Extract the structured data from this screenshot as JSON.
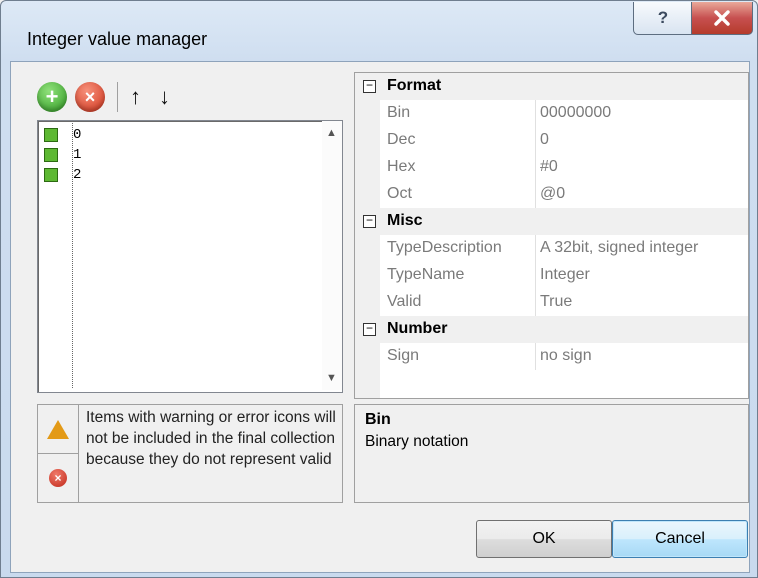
{
  "window": {
    "title": "Integer value manager",
    "help_glyph": "?",
    "close_glyph": "X"
  },
  "toolbar": {
    "add_glyph": "+",
    "remove_glyph": "×",
    "up_glyph": "↑",
    "down_glyph": "↓"
  },
  "list": {
    "items": [
      {
        "label": "0"
      },
      {
        "label": "1"
      },
      {
        "label": "2"
      }
    ]
  },
  "warning": {
    "text": "Items with warning or error icons will not be included in the final collection because they do not represent valid"
  },
  "property_grid": {
    "categories": [
      {
        "name": "Format",
        "expander": "−",
        "properties": [
          {
            "name": "Bin",
            "value": "00000000"
          },
          {
            "name": "Dec",
            "value": "0"
          },
          {
            "name": "Hex",
            "value": "#0"
          },
          {
            "name": "Oct",
            "value": "@0"
          }
        ]
      },
      {
        "name": "Misc",
        "expander": "−",
        "properties": [
          {
            "name": "TypeDescription",
            "value": "A 32bit, signed integer"
          },
          {
            "name": "TypeName",
            "value": "Integer"
          },
          {
            "name": "Valid",
            "value": "True"
          }
        ]
      },
      {
        "name": "Number",
        "expander": "−",
        "properties": [
          {
            "name": "Sign",
            "value": "no sign"
          }
        ]
      }
    ]
  },
  "description": {
    "title": "Bin",
    "text": "Binary notation"
  },
  "buttons": {
    "ok": "OK",
    "cancel": "Cancel"
  }
}
